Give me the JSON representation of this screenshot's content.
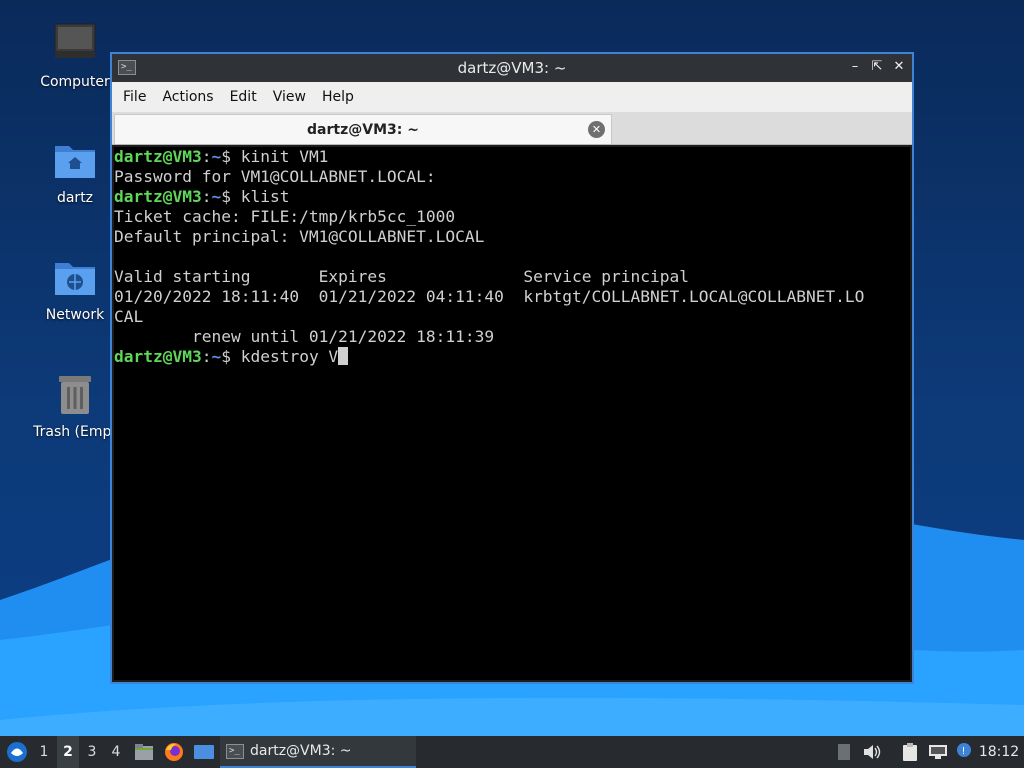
{
  "desktop": {
    "icons": [
      {
        "name": "computer",
        "label": "Computer"
      },
      {
        "name": "home",
        "label": "dartz"
      },
      {
        "name": "network",
        "label": "Network"
      },
      {
        "name": "trash",
        "label": "Trash (Empt"
      }
    ]
  },
  "window": {
    "title": "dartz@VM3: ~",
    "controls": [
      "minimize",
      "maximize",
      "close"
    ],
    "menu": [
      "File",
      "Actions",
      "Edit",
      "View",
      "Help"
    ],
    "tab": {
      "title": "dartz@VM3: ~"
    }
  },
  "terminal": {
    "prompt_user": "dartz@VM3",
    "prompt_path": "~",
    "lines": [
      {
        "type": "prompt",
        "command": "kinit VM1"
      },
      {
        "type": "output",
        "text": "Password for VM1@COLLABNET.LOCAL:"
      },
      {
        "type": "prompt",
        "command": "klist"
      },
      {
        "type": "output",
        "text": "Ticket cache: FILE:/tmp/krb5cc_1000"
      },
      {
        "type": "output",
        "text": "Default principal: VM1@COLLABNET.LOCAL"
      },
      {
        "type": "output",
        "text": ""
      },
      {
        "type": "output",
        "text": "Valid starting       Expires              Service principal"
      },
      {
        "type": "output",
        "text": "01/20/2022 18:11:40  01/21/2022 04:11:40  krbtgt/COLLABNET.LOCAL@COLLABNET.LO"
      },
      {
        "type": "output",
        "text": "CAL"
      },
      {
        "type": "output",
        "text": "        renew until 01/21/2022 18:11:39"
      },
      {
        "type": "prompt",
        "command": "kdestroy V",
        "cursor": true
      }
    ]
  },
  "taskbar": {
    "workspaces": [
      "1",
      "2",
      "3",
      "4"
    ],
    "active_workspace": "2",
    "task_title": "dartz@VM3: ~",
    "clock": "18:12"
  },
  "colors": {
    "accent": "#3d83d6",
    "prompt_user": "#5fd758",
    "prompt_path": "#5c8fe0"
  }
}
